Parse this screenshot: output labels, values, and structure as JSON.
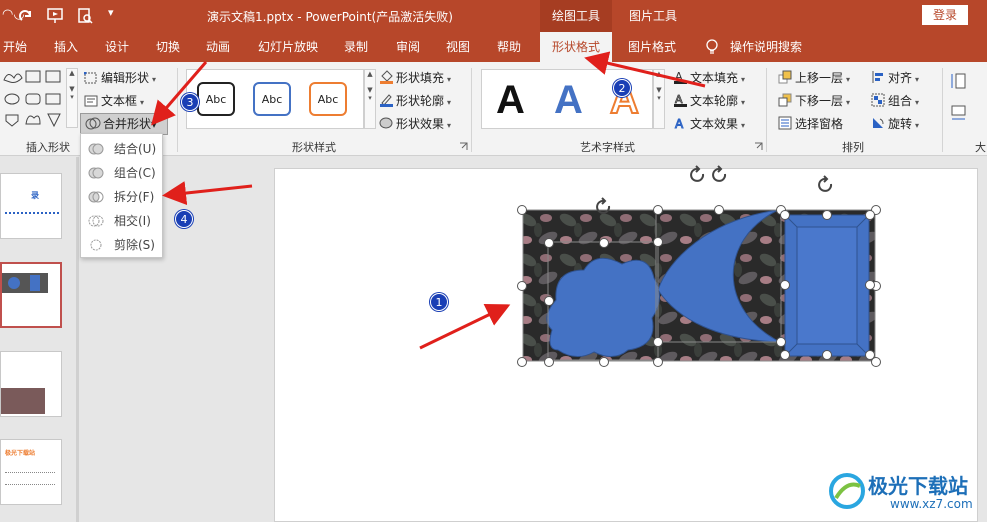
{
  "titlebar": {
    "undo_icon": "undo-icon",
    "title": "演示文稿1.pptx  -  PowerPoint(产品激活失败)",
    "context_groups": [
      "绘图工具",
      "图片工具"
    ],
    "login": "登录"
  },
  "tabs": [
    "开始",
    "插入",
    "设计",
    "切换",
    "动画",
    "幻灯片放映",
    "录制",
    "审阅",
    "视图",
    "帮助",
    "形状格式",
    "图片格式",
    "操作说明搜索"
  ],
  "ribbon": {
    "insert_shapes": {
      "label": "插入形状",
      "edit_shape": "编辑形状",
      "textbox": "文本框",
      "merge_shapes": "合并形状"
    },
    "shape_styles": {
      "label": "形状样式",
      "gallery": [
        "Abc",
        "Abc",
        "Abc"
      ],
      "fill": "形状填充",
      "outline": "形状轮廓",
      "effects": "形状效果"
    },
    "wordart": {
      "label": "艺术字样式",
      "letters": [
        "A",
        "A",
        "A"
      ],
      "text_fill": "文本填充",
      "text_outline": "文本轮廓",
      "text_effects": "文本效果"
    },
    "arrange": {
      "label": "排列",
      "bring_forward": "上移一层",
      "send_backward": "下移一层",
      "selection_pane": "选择窗格",
      "align": "对齐",
      "group": "组合",
      "rotate": "旋转"
    },
    "size": {
      "label": "大"
    }
  },
  "merge_menu": {
    "items": [
      "结合(U)",
      "组合(C)",
      "拆分(F)",
      "相交(I)",
      "剪除(S)"
    ]
  },
  "thumbnails": {
    "first_title": "录",
    "fourth_title": "极光下载站"
  },
  "badges": [
    "1",
    "2",
    "3",
    "4"
  ],
  "watermark": {
    "text": "极光下载站",
    "url": "www.xz7.com"
  },
  "colors": {
    "accent": "#b7472a",
    "shape_blue": "#4472c4",
    "arrow_red": "#e0201b",
    "badge_blue": "#1a3fb5"
  }
}
